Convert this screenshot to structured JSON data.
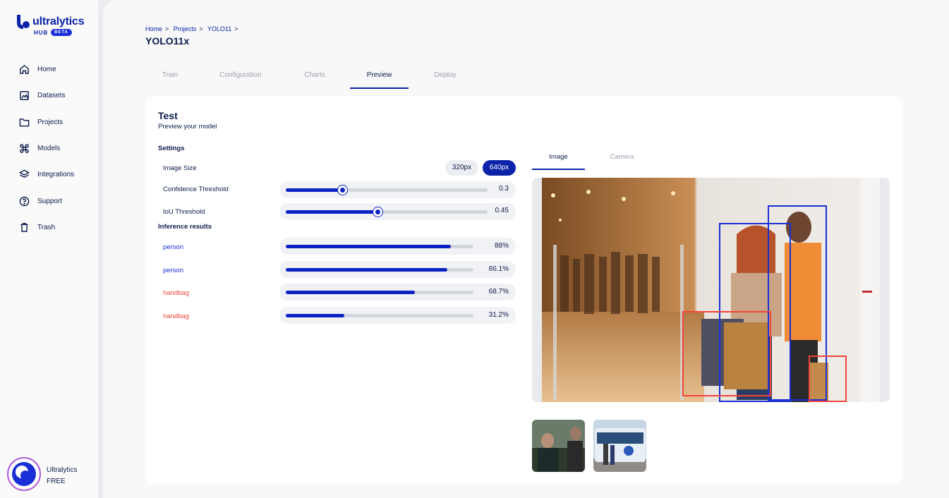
{
  "brand": {
    "name": "ultralytics",
    "product": "HUB",
    "badge": "BETA"
  },
  "sidebar": {
    "items": [
      {
        "label": "Home",
        "icon": "home-icon"
      },
      {
        "label": "Datasets",
        "icon": "image-icon"
      },
      {
        "label": "Projects",
        "icon": "folder-icon"
      },
      {
        "label": "Models",
        "icon": "command-icon"
      },
      {
        "label": "Integrations",
        "icon": "layers-icon"
      },
      {
        "label": "Support",
        "icon": "help-circle-icon"
      },
      {
        "label": "Trash",
        "icon": "trash-icon"
      }
    ],
    "account": {
      "name": "Ultralytics",
      "plan": "FREE"
    }
  },
  "breadcrumb": [
    "Home",
    "Projects",
    "YOLO11"
  ],
  "page_title": "YOLO11x",
  "tabs": [
    "Train",
    "Configuration",
    "Charts",
    "Preview",
    "Deploy"
  ],
  "active_tab": "Preview",
  "test": {
    "title": "Test",
    "subtitle": "Preview your model",
    "settings_label": "Settings",
    "image_size_label": "Image Size",
    "image_sizes": [
      "320px",
      "640px"
    ],
    "selected_size": "640px",
    "confidence_label": "Confidence Threshold",
    "confidence_value": "0.3",
    "iou_label": "IoU Threshold",
    "iou_value": "0.45",
    "inference_label": "Inference results",
    "results": [
      {
        "label": "person",
        "value": "88%",
        "fraction": 0.88,
        "color": "#1a2fd6"
      },
      {
        "label": "person",
        "value": "86.1%",
        "fraction": 0.861,
        "color": "#1a2fd6"
      },
      {
        "label": "handbag",
        "value": "68.7%",
        "fraction": 0.687,
        "color": "#f0453a"
      },
      {
        "label": "handbag",
        "value": "31.2%",
        "fraction": 0.312,
        "color": "#f0453a"
      }
    ]
  },
  "preview_tabs": [
    "Image",
    "Camera"
  ],
  "active_preview_tab": "Image",
  "colors": {
    "accent": "#0b23a8",
    "person": "#1a2fd6",
    "handbag": "#f0453a"
  }
}
